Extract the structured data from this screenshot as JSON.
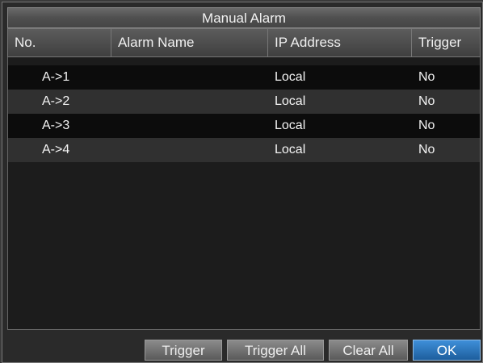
{
  "dialog": {
    "title": "Manual Alarm"
  },
  "table": {
    "columns": [
      "No.",
      "Alarm Name",
      "IP Address",
      "Trigger"
    ],
    "rows": [
      {
        "no": "A->1",
        "name": "",
        "ip": "Local",
        "trigger": "No"
      },
      {
        "no": "A->2",
        "name": "",
        "ip": "Local",
        "trigger": "No"
      },
      {
        "no": "A->3",
        "name": "",
        "ip": "Local",
        "trigger": "No"
      },
      {
        "no": "A->4",
        "name": "",
        "ip": "Local",
        "trigger": "No"
      }
    ]
  },
  "buttons": {
    "trigger": "Trigger",
    "trigger_all": "Trigger All",
    "clear_all": "Clear All",
    "ok": "OK"
  },
  "colors": {
    "accent": "#2e7bc7",
    "row_dark": "#0c0c0c",
    "row_light": "#303030"
  }
}
